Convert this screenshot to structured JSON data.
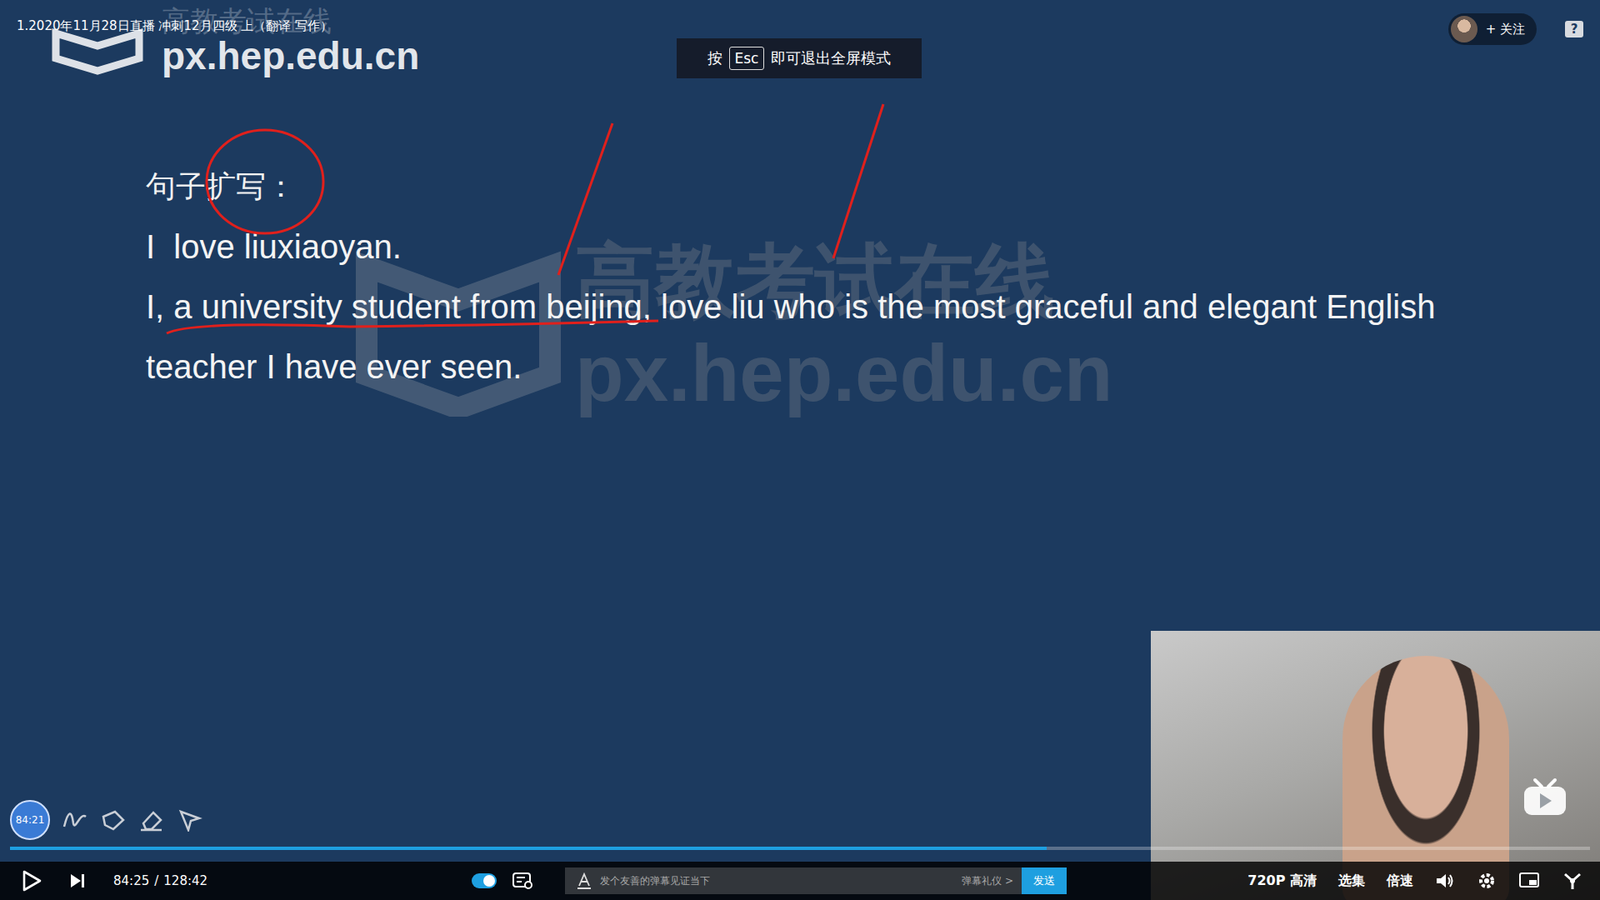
{
  "video": {
    "title": "1.2020年11月28日直播 冲刺12月四级 上（翻译 写作）",
    "watermark": "px.hep.edu.cn",
    "brand": "高教考试在线",
    "marker_time": "84:21"
  },
  "slide": {
    "heading": "句子扩写：",
    "lines": [
      "I  love liuxiaoyan.",
      "I, a university student from beijing, love liu who is the most graceful and elegant English teacher I have ever seen."
    ]
  },
  "toast": {
    "prefix": "按",
    "key": "Esc",
    "suffix": "即可退出全屏模式"
  },
  "header": {
    "follow": "+ 关注",
    "help": "?"
  },
  "player": {
    "current_time": "84:25",
    "separator": "/",
    "duration": "128:42",
    "progress": 0.656,
    "danmaku_on": true,
    "danmaku_placeholder": "发个友善的弹幕见证当下",
    "danmaku_etiquette": "弹幕礼仪 >",
    "send": "发送",
    "quality": "720P 高清",
    "episodes": "选集",
    "speed": "倍速"
  }
}
